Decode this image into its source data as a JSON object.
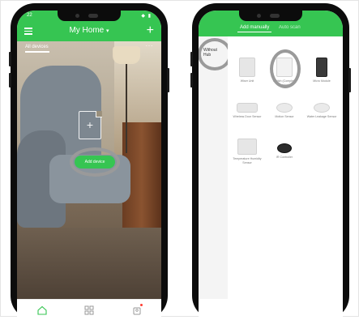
{
  "phone1": {
    "status_time": "22",
    "status_icons": "◆ ▮",
    "header_title": "My Home",
    "header_title_chevron": "chevron-down-icon",
    "menu_icon": "menu-icon",
    "plus_icon": "+",
    "all_devices_label": "All devices",
    "more_label": "···",
    "empty_icon": "add-document-icon",
    "add_device_label": "Add device",
    "tabs": [
      {
        "name": "home-tab",
        "icon": "home-icon",
        "active": true
      },
      {
        "name": "scenes-tab",
        "icon": "grid-icon",
        "active": false
      },
      {
        "name": "profile-tab",
        "icon": "user-icon",
        "active": false,
        "badge": true
      }
    ]
  },
  "phone2": {
    "tabs": [
      {
        "label": "Add manually",
        "active": true
      },
      {
        "label": "Auto scan",
        "active": false
      }
    ],
    "sidebar_label_line1": "Without",
    "sidebar_label_line2": "Hub",
    "devices": [
      {
        "label": "Wiser Unit",
        "style": "plain"
      },
      {
        "label": "Switch (Complete Device)",
        "style": "plain"
      },
      {
        "label": "Micro Module",
        "style": "dark"
      },
      {
        "label": "Wireless Door Sensor",
        "style": "flat"
      },
      {
        "label": "Motion Sensor",
        "style": "puck"
      },
      {
        "label": "Water Leakage Sensor",
        "style": "puck"
      },
      {
        "label": "Temperature Humidity Sensor",
        "style": "square"
      },
      {
        "label": "IR Controller",
        "style": "round-black"
      }
    ]
  },
  "colors": {
    "brand_green": "#36c552",
    "highlight_ring": "#9a9a9a",
    "phone_body": "#0c0c0c"
  }
}
